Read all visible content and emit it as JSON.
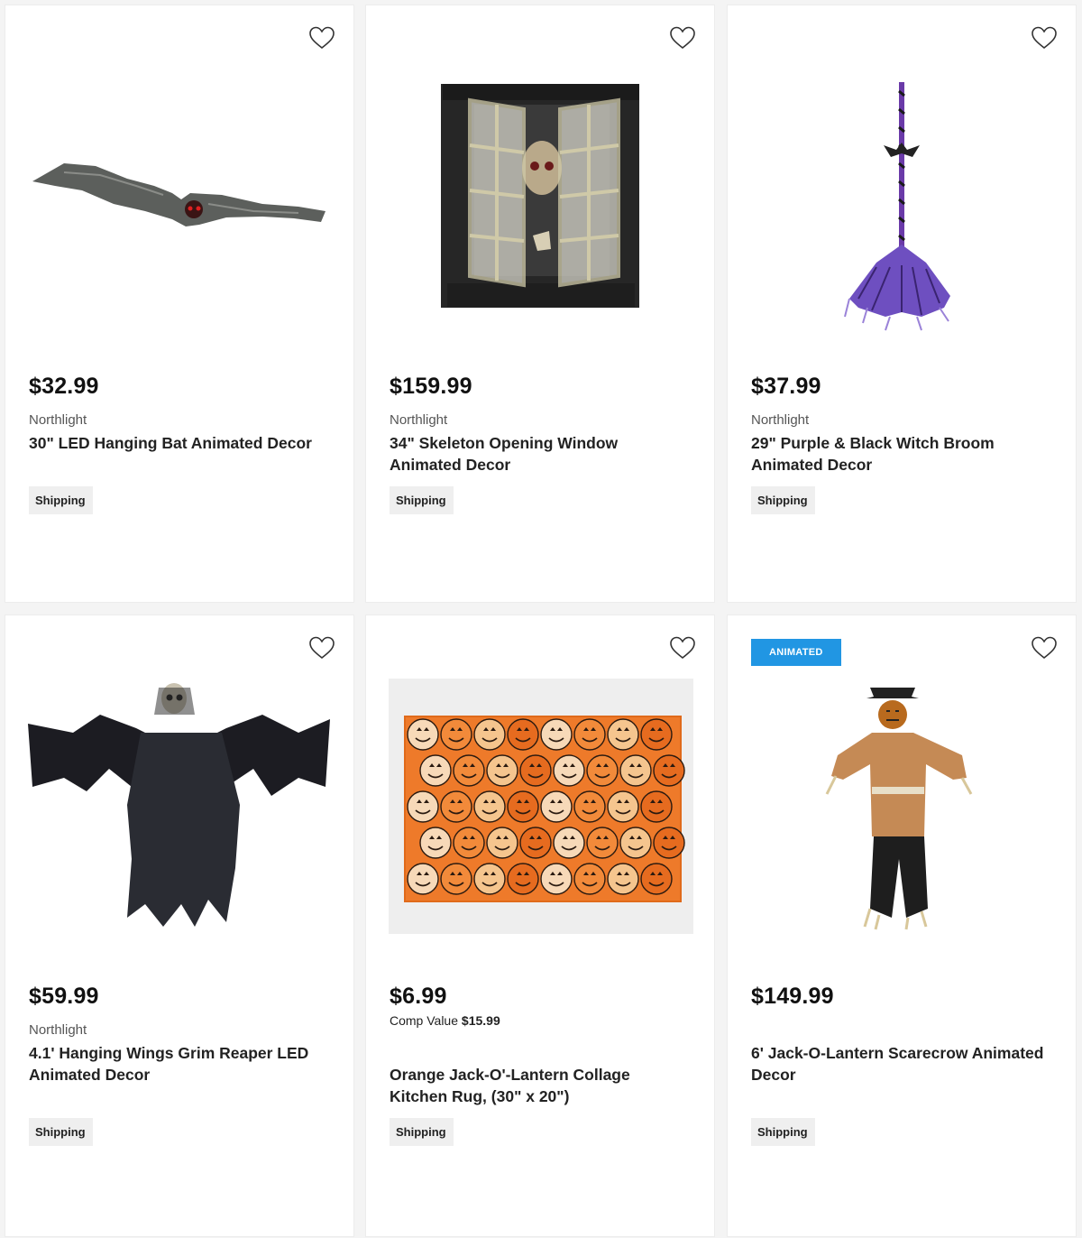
{
  "products": [
    {
      "price": "$32.99",
      "brand": "Northlight",
      "title": "30\" LED Hanging Bat Animated Decor",
      "shipping": "Shipping",
      "favorite_icon": "heart-outline-icon"
    },
    {
      "price": "$159.99",
      "brand": "Northlight",
      "title": "34\" Skeleton Opening Window Animated Decor",
      "shipping": "Shipping",
      "favorite_icon": "heart-outline-icon"
    },
    {
      "price": "$37.99",
      "brand": "Northlight",
      "title": "29\" Purple & Black Witch Broom Animated Decor",
      "shipping": "Shipping",
      "favorite_icon": "heart-outline-icon"
    },
    {
      "price": "$59.99",
      "brand": "Northlight",
      "title": "4.1' Hanging Wings Grim Reaper LED Animated Decor",
      "shipping": "Shipping",
      "favorite_icon": "heart-outline-icon"
    },
    {
      "price": "$6.99",
      "comp_label": "Comp Value",
      "comp_value": "$15.99",
      "title": "Orange Jack-O'-Lantern Collage Kitchen Rug, (30\" x 20\")",
      "shipping": "Shipping",
      "favorite_icon": "heart-outline-icon"
    },
    {
      "price": "$149.99",
      "badge": "ANIMATED",
      "title": "6' Jack-O-Lantern Scarecrow Animated Decor",
      "shipping": "Shipping",
      "favorite_icon": "heart-outline-icon"
    }
  ],
  "colors": {
    "badge": "#2196e3",
    "shipping_bg": "#efefef",
    "price": "#111111",
    "brand": "#555555"
  }
}
